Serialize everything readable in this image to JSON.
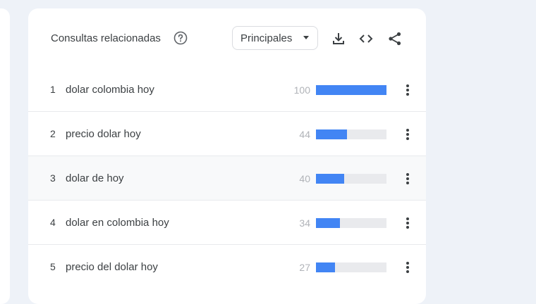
{
  "panel": {
    "title": "Consultas relacionadas",
    "dropdown_label": "Principales",
    "icons": [
      "help-icon",
      "download-icon",
      "embed-code-icon",
      "share-icon"
    ]
  },
  "rows": [
    {
      "rank": "1",
      "query": "dolar colombia hoy",
      "value": "100",
      "fraction": 1.0
    },
    {
      "rank": "2",
      "query": "precio dolar hoy",
      "value": "44",
      "fraction": 0.44
    },
    {
      "rank": "3",
      "query": "dolar de hoy",
      "value": "40",
      "fraction": 0.4
    },
    {
      "rank": "4",
      "query": "dolar en colombia hoy",
      "value": "34",
      "fraction": 0.34
    },
    {
      "rank": "5",
      "query": "precio del dolar hoy",
      "value": "27",
      "fraction": 0.27
    }
  ],
  "colors": {
    "bar": "#4285f4",
    "track": "#e9eaed",
    "text": "#3c4043",
    "value_text": "#b0b3b8"
  }
}
